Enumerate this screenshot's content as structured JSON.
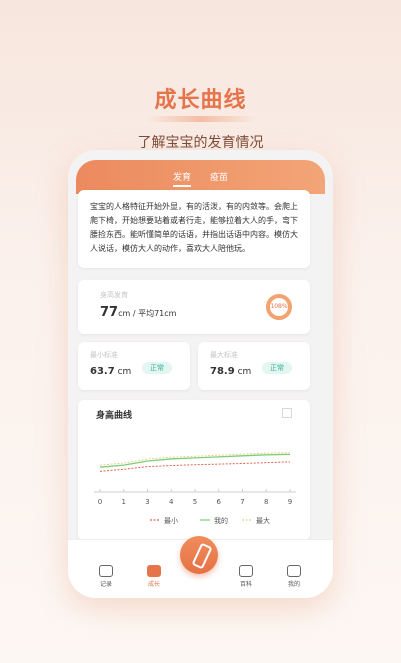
{
  "header": {
    "title": "成长曲线",
    "subtitle": "了解宝宝的发育情况"
  },
  "tabs": [
    {
      "label": "发育",
      "active": true
    },
    {
      "label": "疫苗",
      "active": false
    }
  ],
  "description": "宝宝的人格特征开始外显，有的活泼，有的内敛等。会爬上爬下椅，开始想要站着或者行走，能够拉着大人的手，弯下腰捡东西。能听懂简单的话语，并指出话语中内容。模仿大人说话，模仿大人的动作，喜欢大人陪他玩。",
  "height_card": {
    "label": "身高发育",
    "value": "77",
    "unit": "cm",
    "avg": "/ 平均71cm",
    "percent": "108%",
    "percent_value": 108
  },
  "min_card": {
    "label": "最小标准",
    "value": "63.7",
    "unit": "cm",
    "status": "正常"
  },
  "max_card": {
    "label": "最大标准",
    "value": "78.9",
    "unit": "cm",
    "status": "正常"
  },
  "chart_data": {
    "type": "line",
    "title": "身高曲线",
    "x": [
      0,
      1,
      3,
      4,
      5,
      6,
      7,
      8,
      9
    ],
    "series": [
      {
        "name": "最小",
        "color": "#e0654e",
        "values": [
          60,
          61,
          62.3,
          62.8,
          63.2,
          63.5,
          63.8,
          64.2,
          64.6
        ]
      },
      {
        "name": "我的",
        "color": "#7bcf78",
        "values": [
          62,
          63,
          65,
          66,
          66.5,
          67,
          67.5,
          68,
          68.2
        ]
      },
      {
        "name": "最大",
        "color": "#e8d08c",
        "values": [
          63,
          64,
          66,
          66.8,
          67.3,
          67.8,
          68.3,
          68.8,
          69
        ]
      }
    ],
    "ylim": [
      50,
      80
    ]
  },
  "tabbar": [
    {
      "label": "记录",
      "icon": "clock-icon"
    },
    {
      "label": "成长",
      "icon": "growth-icon",
      "active": true
    },
    {
      "label": "",
      "icon": "bottle-icon"
    },
    {
      "label": "百科",
      "icon": "book-icon"
    },
    {
      "label": "我的",
      "icon": "user-icon"
    }
  ]
}
